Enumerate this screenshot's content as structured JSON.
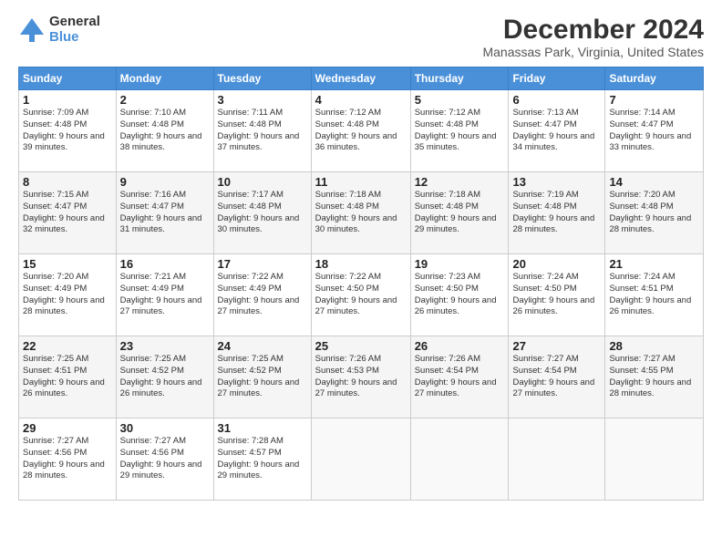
{
  "logo": {
    "general": "General",
    "blue": "Blue"
  },
  "title": "December 2024",
  "location": "Manassas Park, Virginia, United States",
  "headers": [
    "Sunday",
    "Monday",
    "Tuesday",
    "Wednesday",
    "Thursday",
    "Friday",
    "Saturday"
  ],
  "weeks": [
    [
      {
        "day": "1",
        "sunrise": "Sunrise: 7:09 AM",
        "sunset": "Sunset: 4:48 PM",
        "daylight": "Daylight: 9 hours and 39 minutes."
      },
      {
        "day": "2",
        "sunrise": "Sunrise: 7:10 AM",
        "sunset": "Sunset: 4:48 PM",
        "daylight": "Daylight: 9 hours and 38 minutes."
      },
      {
        "day": "3",
        "sunrise": "Sunrise: 7:11 AM",
        "sunset": "Sunset: 4:48 PM",
        "daylight": "Daylight: 9 hours and 37 minutes."
      },
      {
        "day": "4",
        "sunrise": "Sunrise: 7:12 AM",
        "sunset": "Sunset: 4:48 PM",
        "daylight": "Daylight: 9 hours and 36 minutes."
      },
      {
        "day": "5",
        "sunrise": "Sunrise: 7:12 AM",
        "sunset": "Sunset: 4:48 PM",
        "daylight": "Daylight: 9 hours and 35 minutes."
      },
      {
        "day": "6",
        "sunrise": "Sunrise: 7:13 AM",
        "sunset": "Sunset: 4:47 PM",
        "daylight": "Daylight: 9 hours and 34 minutes."
      },
      {
        "day": "7",
        "sunrise": "Sunrise: 7:14 AM",
        "sunset": "Sunset: 4:47 PM",
        "daylight": "Daylight: 9 hours and 33 minutes."
      }
    ],
    [
      {
        "day": "8",
        "sunrise": "Sunrise: 7:15 AM",
        "sunset": "Sunset: 4:47 PM",
        "daylight": "Daylight: 9 hours and 32 minutes."
      },
      {
        "day": "9",
        "sunrise": "Sunrise: 7:16 AM",
        "sunset": "Sunset: 4:47 PM",
        "daylight": "Daylight: 9 hours and 31 minutes."
      },
      {
        "day": "10",
        "sunrise": "Sunrise: 7:17 AM",
        "sunset": "Sunset: 4:48 PM",
        "daylight": "Daylight: 9 hours and 30 minutes."
      },
      {
        "day": "11",
        "sunrise": "Sunrise: 7:18 AM",
        "sunset": "Sunset: 4:48 PM",
        "daylight": "Daylight: 9 hours and 30 minutes."
      },
      {
        "day": "12",
        "sunrise": "Sunrise: 7:18 AM",
        "sunset": "Sunset: 4:48 PM",
        "daylight": "Daylight: 9 hours and 29 minutes."
      },
      {
        "day": "13",
        "sunrise": "Sunrise: 7:19 AM",
        "sunset": "Sunset: 4:48 PM",
        "daylight": "Daylight: 9 hours and 28 minutes."
      },
      {
        "day": "14",
        "sunrise": "Sunrise: 7:20 AM",
        "sunset": "Sunset: 4:48 PM",
        "daylight": "Daylight: 9 hours and 28 minutes."
      }
    ],
    [
      {
        "day": "15",
        "sunrise": "Sunrise: 7:20 AM",
        "sunset": "Sunset: 4:49 PM",
        "daylight": "Daylight: 9 hours and 28 minutes."
      },
      {
        "day": "16",
        "sunrise": "Sunrise: 7:21 AM",
        "sunset": "Sunset: 4:49 PM",
        "daylight": "Daylight: 9 hours and 27 minutes."
      },
      {
        "day": "17",
        "sunrise": "Sunrise: 7:22 AM",
        "sunset": "Sunset: 4:49 PM",
        "daylight": "Daylight: 9 hours and 27 minutes."
      },
      {
        "day": "18",
        "sunrise": "Sunrise: 7:22 AM",
        "sunset": "Sunset: 4:50 PM",
        "daylight": "Daylight: 9 hours and 27 minutes."
      },
      {
        "day": "19",
        "sunrise": "Sunrise: 7:23 AM",
        "sunset": "Sunset: 4:50 PM",
        "daylight": "Daylight: 9 hours and 26 minutes."
      },
      {
        "day": "20",
        "sunrise": "Sunrise: 7:24 AM",
        "sunset": "Sunset: 4:50 PM",
        "daylight": "Daylight: 9 hours and 26 minutes."
      },
      {
        "day": "21",
        "sunrise": "Sunrise: 7:24 AM",
        "sunset": "Sunset: 4:51 PM",
        "daylight": "Daylight: 9 hours and 26 minutes."
      }
    ],
    [
      {
        "day": "22",
        "sunrise": "Sunrise: 7:25 AM",
        "sunset": "Sunset: 4:51 PM",
        "daylight": "Daylight: 9 hours and 26 minutes."
      },
      {
        "day": "23",
        "sunrise": "Sunrise: 7:25 AM",
        "sunset": "Sunset: 4:52 PM",
        "daylight": "Daylight: 9 hours and 26 minutes."
      },
      {
        "day": "24",
        "sunrise": "Sunrise: 7:25 AM",
        "sunset": "Sunset: 4:52 PM",
        "daylight": "Daylight: 9 hours and 27 minutes."
      },
      {
        "day": "25",
        "sunrise": "Sunrise: 7:26 AM",
        "sunset": "Sunset: 4:53 PM",
        "daylight": "Daylight: 9 hours and 27 minutes."
      },
      {
        "day": "26",
        "sunrise": "Sunrise: 7:26 AM",
        "sunset": "Sunset: 4:54 PM",
        "daylight": "Daylight: 9 hours and 27 minutes."
      },
      {
        "day": "27",
        "sunrise": "Sunrise: 7:27 AM",
        "sunset": "Sunset: 4:54 PM",
        "daylight": "Daylight: 9 hours and 27 minutes."
      },
      {
        "day": "28",
        "sunrise": "Sunrise: 7:27 AM",
        "sunset": "Sunset: 4:55 PM",
        "daylight": "Daylight: 9 hours and 28 minutes."
      }
    ],
    [
      {
        "day": "29",
        "sunrise": "Sunrise: 7:27 AM",
        "sunset": "Sunset: 4:56 PM",
        "daylight": "Daylight: 9 hours and 28 minutes."
      },
      {
        "day": "30",
        "sunrise": "Sunrise: 7:27 AM",
        "sunset": "Sunset: 4:56 PM",
        "daylight": "Daylight: 9 hours and 29 minutes."
      },
      {
        "day": "31",
        "sunrise": "Sunrise: 7:28 AM",
        "sunset": "Sunset: 4:57 PM",
        "daylight": "Daylight: 9 hours and 29 minutes."
      },
      null,
      null,
      null,
      null
    ]
  ]
}
